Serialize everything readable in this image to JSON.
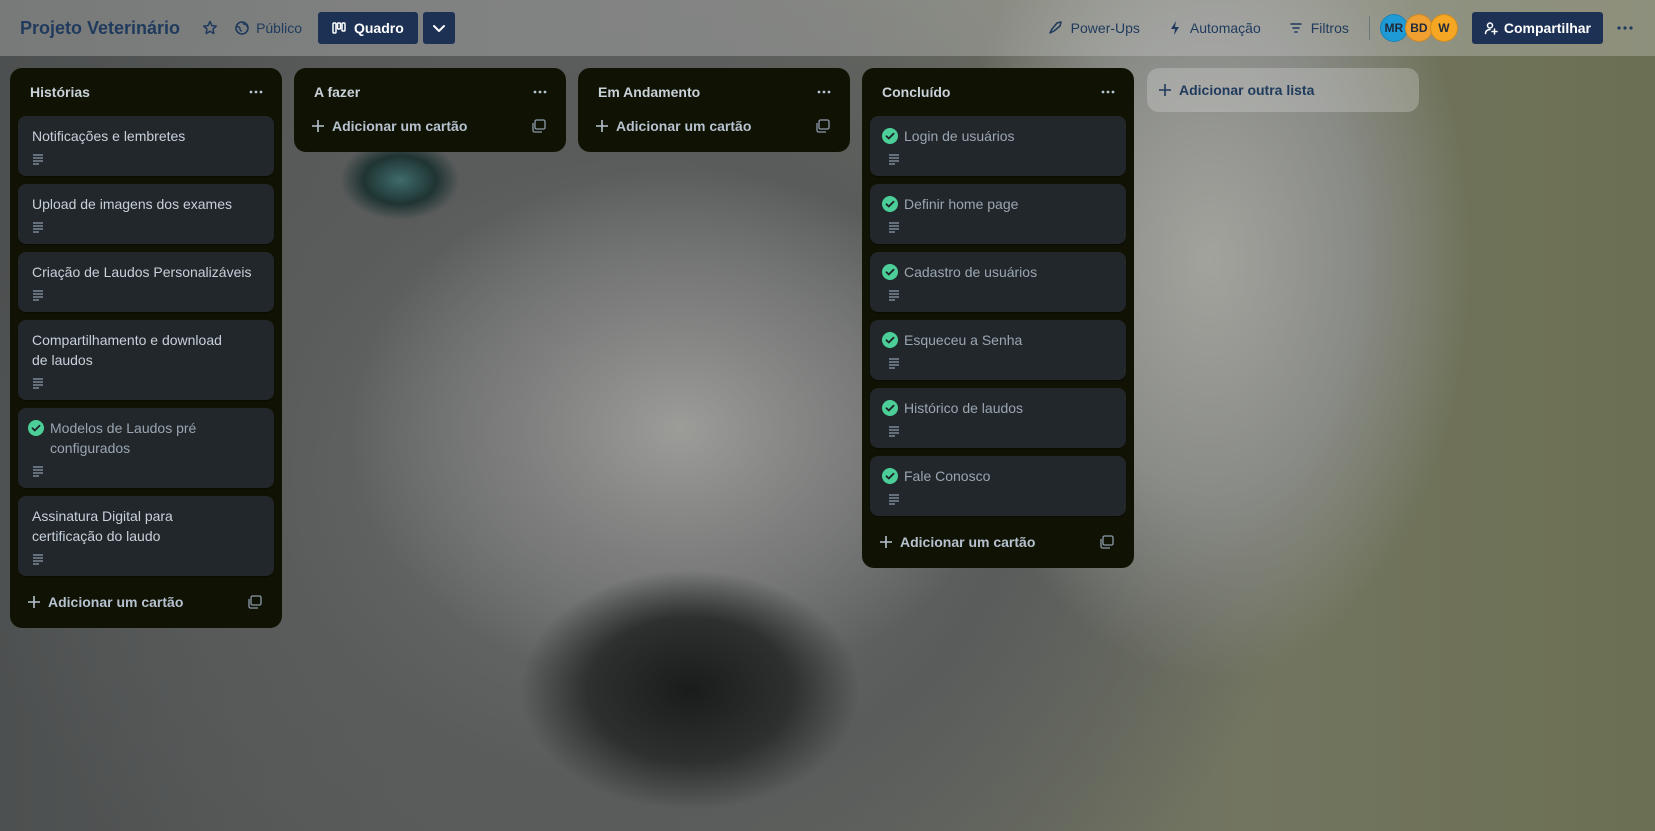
{
  "header": {
    "board_title": "Projeto Veterinário",
    "visibility": "Público",
    "view_label": "Quadro",
    "powerups": "Power-Ups",
    "automation": "Automação",
    "filters": "Filtros",
    "share": "Compartilhar",
    "avatars": [
      {
        "initials": "MR",
        "color": "#1e9bd7"
      },
      {
        "initials": "BD",
        "color": "#f0a030"
      },
      {
        "initials": "W",
        "color": "#f5a623"
      }
    ]
  },
  "lists": [
    {
      "title": "Histórias",
      "add_label": "Adicionar um cartão",
      "cards": [
        {
          "title": "Notificações e lembretes",
          "done": false
        },
        {
          "title": "Upload de imagens dos exames",
          "done": false
        },
        {
          "title": "Criação de Laudos Personalizáveis",
          "done": false
        },
        {
          "title": "Compartilhamento e download de laudos",
          "done": false
        },
        {
          "title": "Modelos de Laudos pré configurados",
          "done": true
        },
        {
          "title": "Assinatura Digital para certificação do laudo",
          "done": false
        }
      ]
    },
    {
      "title": "A fazer",
      "add_label": "Adicionar um cartão",
      "cards": []
    },
    {
      "title": "Em Andamento",
      "add_label": "Adicionar um cartão",
      "cards": []
    },
    {
      "title": "Concluído",
      "add_label": "Adicionar um cartão",
      "cards": [
        {
          "title": "Login de usuários",
          "done": true
        },
        {
          "title": "Definir home page",
          "done": true
        },
        {
          "title": "Cadastro de usuários",
          "done": true
        },
        {
          "title": "Esqueceu a Senha",
          "done": true
        },
        {
          "title": "Histórico de laudos",
          "done": true
        },
        {
          "title": "Fale Conosco",
          "done": true
        }
      ]
    }
  ],
  "add_list_label": "Adicionar outra lista",
  "colors": {
    "list_bg": "#101204",
    "card_bg": "#22272b",
    "check_green": "#4bce97",
    "header_button": "#1d3155"
  }
}
